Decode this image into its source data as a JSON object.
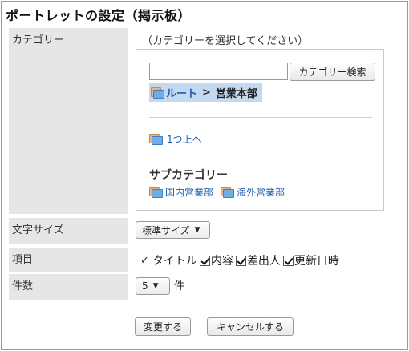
{
  "page": {
    "title": "ポートレットの設定（掲示板）"
  },
  "category": {
    "label": "カテゴリー",
    "hint": "（カテゴリーを選択してください）",
    "search": {
      "placeholder": "",
      "value": "",
      "button_label": "カテゴリー検索"
    },
    "breadcrumb": {
      "root": "ルート",
      "separator": ">",
      "current": "営業本部"
    },
    "up_link": "1つ上へ",
    "subcategory_title": "サブカテゴリー",
    "subcategories": [
      "国内営業部",
      "海外営業部"
    ]
  },
  "font_size": {
    "label": "文字サイズ",
    "selected": "標準サイズ"
  },
  "fields": {
    "label": "項目",
    "title_item": "タイトル",
    "checkboxes": [
      {
        "label": "内容",
        "checked": true
      },
      {
        "label": "差出人",
        "checked": true
      },
      {
        "label": "更新日時",
        "checked": true
      }
    ]
  },
  "count": {
    "label": "件数",
    "selected": "5",
    "unit": "件"
  },
  "actions": {
    "change_label": "変更する",
    "cancel_label": "キャンセルする"
  }
}
